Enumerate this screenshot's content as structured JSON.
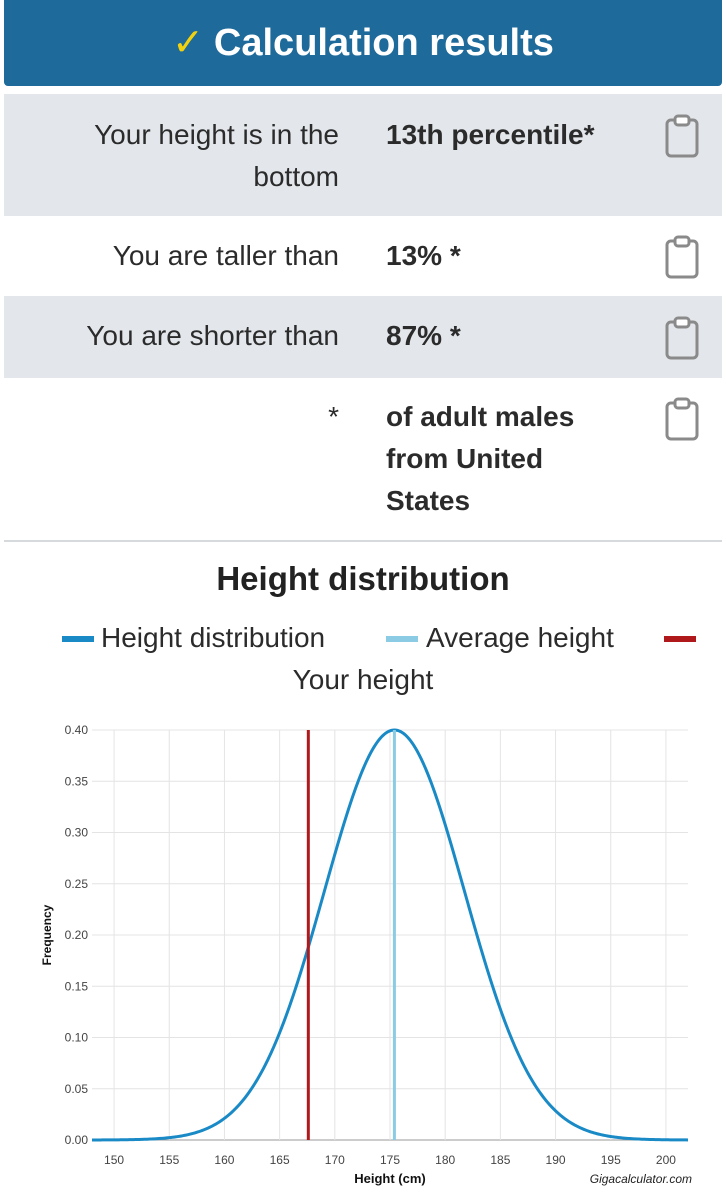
{
  "header": {
    "title": "Calculation results",
    "check_icon": "checkmark-icon",
    "bg_color": "#1d6a9b",
    "check_color": "#f2d20f"
  },
  "results": [
    {
      "label": "Your height is in the bottom",
      "value": "13th percentile*"
    },
    {
      "label": "You are taller than",
      "value": "13% *"
    },
    {
      "label": "You are shorter than",
      "value": "87% *"
    },
    {
      "label": "*",
      "value": "of adult males from United States"
    }
  ],
  "chart_data": {
    "type": "line",
    "title": "Height distribution",
    "xlabel": "Height (cm)",
    "ylabel": "Frequency",
    "credit": "Gigacalculator.com",
    "xlim": [
      148,
      202
    ],
    "ylim": [
      0,
      0.4
    ],
    "xticks": [
      "150",
      "155",
      "160",
      "165",
      "170",
      "175",
      "180",
      "185",
      "190",
      "195",
      "200"
    ],
    "yticks": [
      "0.00",
      "0.05",
      "0.10",
      "0.15",
      "0.20",
      "0.25",
      "0.30",
      "0.35",
      "0.40"
    ],
    "grid": true,
    "legend_position": "top",
    "series": [
      {
        "name": "Height distribution",
        "color": "#1a8ac6",
        "kind": "normal-curve",
        "mean": 175.4,
        "sd_cm": 6.35,
        "peak": 0.4
      },
      {
        "name": "Average height",
        "color": "#8ccbe4",
        "kind": "vertical-line",
        "x": 175.4
      },
      {
        "name": "Your height",
        "color": "#b0191c",
        "kind": "vertical-line",
        "x": 167.6
      }
    ]
  }
}
